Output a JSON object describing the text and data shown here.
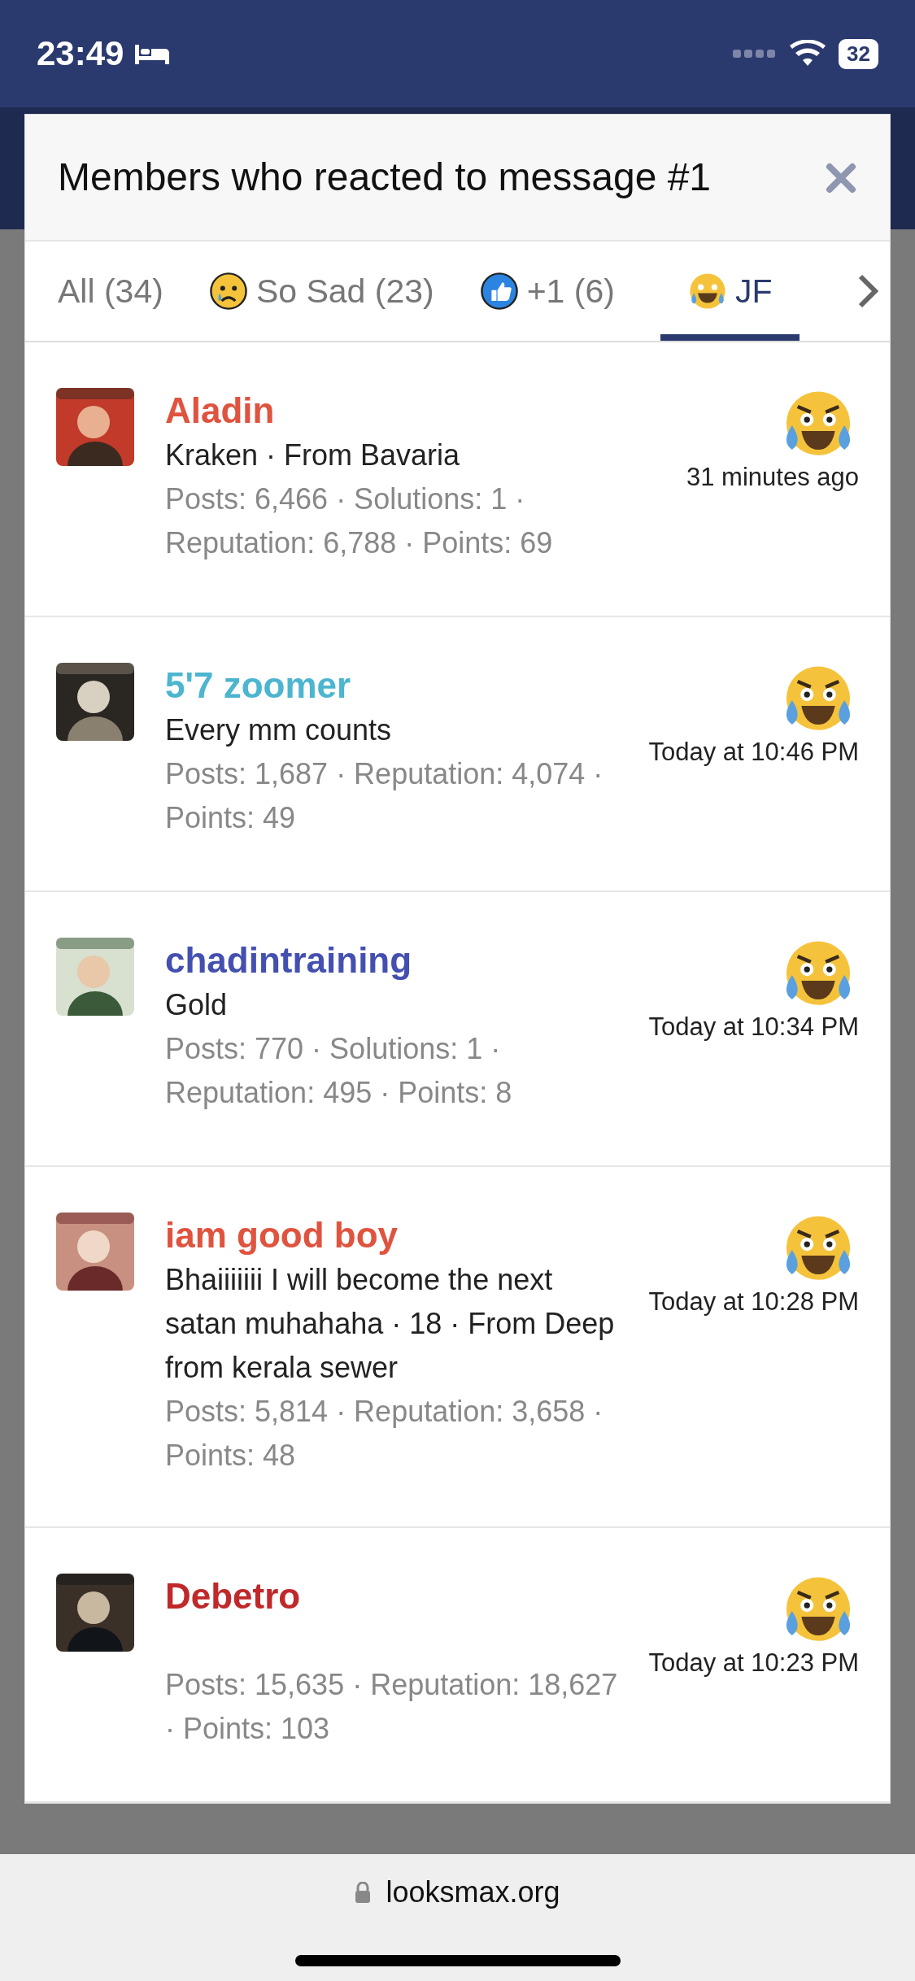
{
  "status_bar": {
    "time": "23:49",
    "battery": "32"
  },
  "dialog": {
    "title": "Members who reacted to message #1"
  },
  "tabs": [
    {
      "label": "All (34)",
      "kind": "plain",
      "selected": false
    },
    {
      "label": "So Sad (23)",
      "kind": "sad",
      "selected": false
    },
    {
      "label": "+1 (6)",
      "kind": "like",
      "selected": false
    },
    {
      "label": "JF",
      "kind": "laugh",
      "selected": true
    }
  ],
  "members": [
    {
      "name": "Aladin",
      "color": "#e0533f",
      "title": "Kraken · From Bavaria",
      "stats": "Posts: 6,466 · Solutions: 1 · Reputation: 6,788 · Points: 69",
      "time": "31 minutes ago"
    },
    {
      "name": "5'7 zoomer",
      "color": "#4cb5cf",
      "title": "Every mm counts",
      "stats": "Posts: 1,687 · Reputation: 4,074 · Points: 49",
      "time": "Today at 10:46 PM"
    },
    {
      "name": "chadintraining",
      "color": "#4450b0",
      "title": "Gold",
      "stats": "Posts: 770 · Solutions: 1 · Reputation: 495 · Points: 8",
      "time": "Today at 10:34 PM"
    },
    {
      "name": "iam good boy",
      "color": "#e0533f",
      "title": "Bhaiiiiiii I will become the next satan muhahaha · 18 · From Deep from kerala sewer",
      "stats": "Posts: 5,814 · Reputation: 3,658 · Points: 48",
      "time": "Today at 10:28 PM"
    },
    {
      "name": "Debetro",
      "color": "#c0282a",
      "stats": "Posts: 15,635 · Reputation: 18,627 · Points: 103",
      "time": "Today at 10:23 PM"
    }
  ],
  "browser_bar": {
    "url": "looksmax.org"
  }
}
